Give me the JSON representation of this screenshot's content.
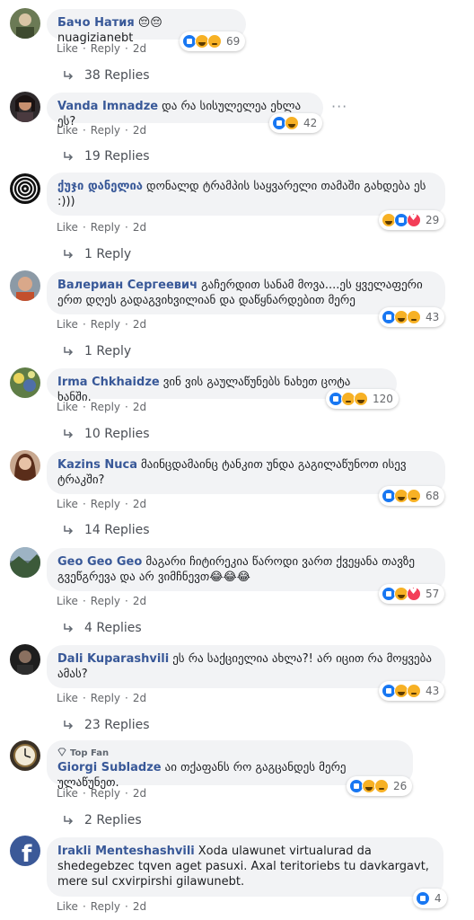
{
  "comments": [
    {
      "author": "Бачо Натия",
      "text": "😔😔nuagizianebt",
      "reactions": "69",
      "icons": [
        "like",
        "haha",
        "sad"
      ],
      "like": "Like",
      "reply": "Reply",
      "time": "2d",
      "replies": "38 Replies"
    },
    {
      "author": "Vanda Imnadze",
      "text": "და რა სისულელეა ეხლა ეს?",
      "reactions": "42",
      "icons": [
        "like",
        "haha"
      ],
      "like": "Like",
      "reply": "Reply",
      "time": "2d",
      "replies": "19 Replies"
    },
    {
      "author": "ქუჯი დანელია",
      "text": "დონალდ ტრამპის საყვარელი თამაში გახდება ეს :)))",
      "reactions": "29",
      "icons": [
        "haha",
        "like",
        "love"
      ],
      "like": "Like",
      "reply": "Reply",
      "time": "2d",
      "replies": "1 Reply"
    },
    {
      "author": "Валериан Сергеевич",
      "text": "გაჩერდით სანამ მოვა....ეს ყველაფერი ერთ დღეს გადაგვიხვილიან და დაწყნარდებით მერე",
      "reactions": "43",
      "icons": [
        "like",
        "haha",
        "sad"
      ],
      "like": "Like",
      "reply": "Reply",
      "time": "2d",
      "replies": "1 Reply"
    },
    {
      "author": "Irma Chkhaidze",
      "text": "ვინ ვის გაულაწუნებს ნახეთ ცოტა ხანში.",
      "reactions": "120",
      "icons": [
        "like",
        "sad",
        "haha"
      ],
      "like": "Like",
      "reply": "Reply",
      "time": "2d",
      "replies": "10 Replies"
    },
    {
      "author": "Kazins Nuca",
      "text": "მაინცდამაინც ტანკით უნდა გაგილაწუნოთ ისევ ტრაკში?",
      "reactions": "68",
      "icons": [
        "like",
        "haha",
        "sad"
      ],
      "like": "Like",
      "reply": "Reply",
      "time": "2d",
      "replies": "14 Replies"
    },
    {
      "author": "Geo Geo Geo",
      "text": "მაგარი ჩიტირეკია წაროდი ვართ ქვეყანა თავზე გვეწგრევა და არ ვიმჩნევთ😂😂😂",
      "reactions": "57",
      "icons": [
        "like",
        "haha",
        "love"
      ],
      "like": "Like",
      "reply": "Reply",
      "time": "2d",
      "replies": "4 Replies"
    },
    {
      "author": "Dali Kuparashvili",
      "text": "ეს რა საქციელია ახლა?! არ იცით რა მოყვება ამას?",
      "reactions": "43",
      "icons": [
        "like",
        "haha",
        "sad"
      ],
      "like": "Like",
      "reply": "Reply",
      "time": "2d",
      "replies": "23 Replies"
    },
    {
      "author": "Giorgi Subladze",
      "badge": "Top Fan",
      "text": "აი თქაფანს რო გაგცანდეს მერე ულაწუნეთ.",
      "reactions": "26",
      "icons": [
        "like",
        "haha",
        "sad"
      ],
      "like": "Like",
      "reply": "Reply",
      "time": "2d",
      "replies": "2 Replies"
    },
    {
      "author": "Irakli Menteshashvili",
      "text": "Xoda ulawunet virtualurad da shedegebzec tqven aget pasuxi. Axal teritoriebs tu davkargavt, mere sul cxvirpirshi gilawunebt.",
      "reactions": "4",
      "icons": [
        "like"
      ],
      "like": "Like",
      "reply": "Reply",
      "time": "2d"
    }
  ]
}
